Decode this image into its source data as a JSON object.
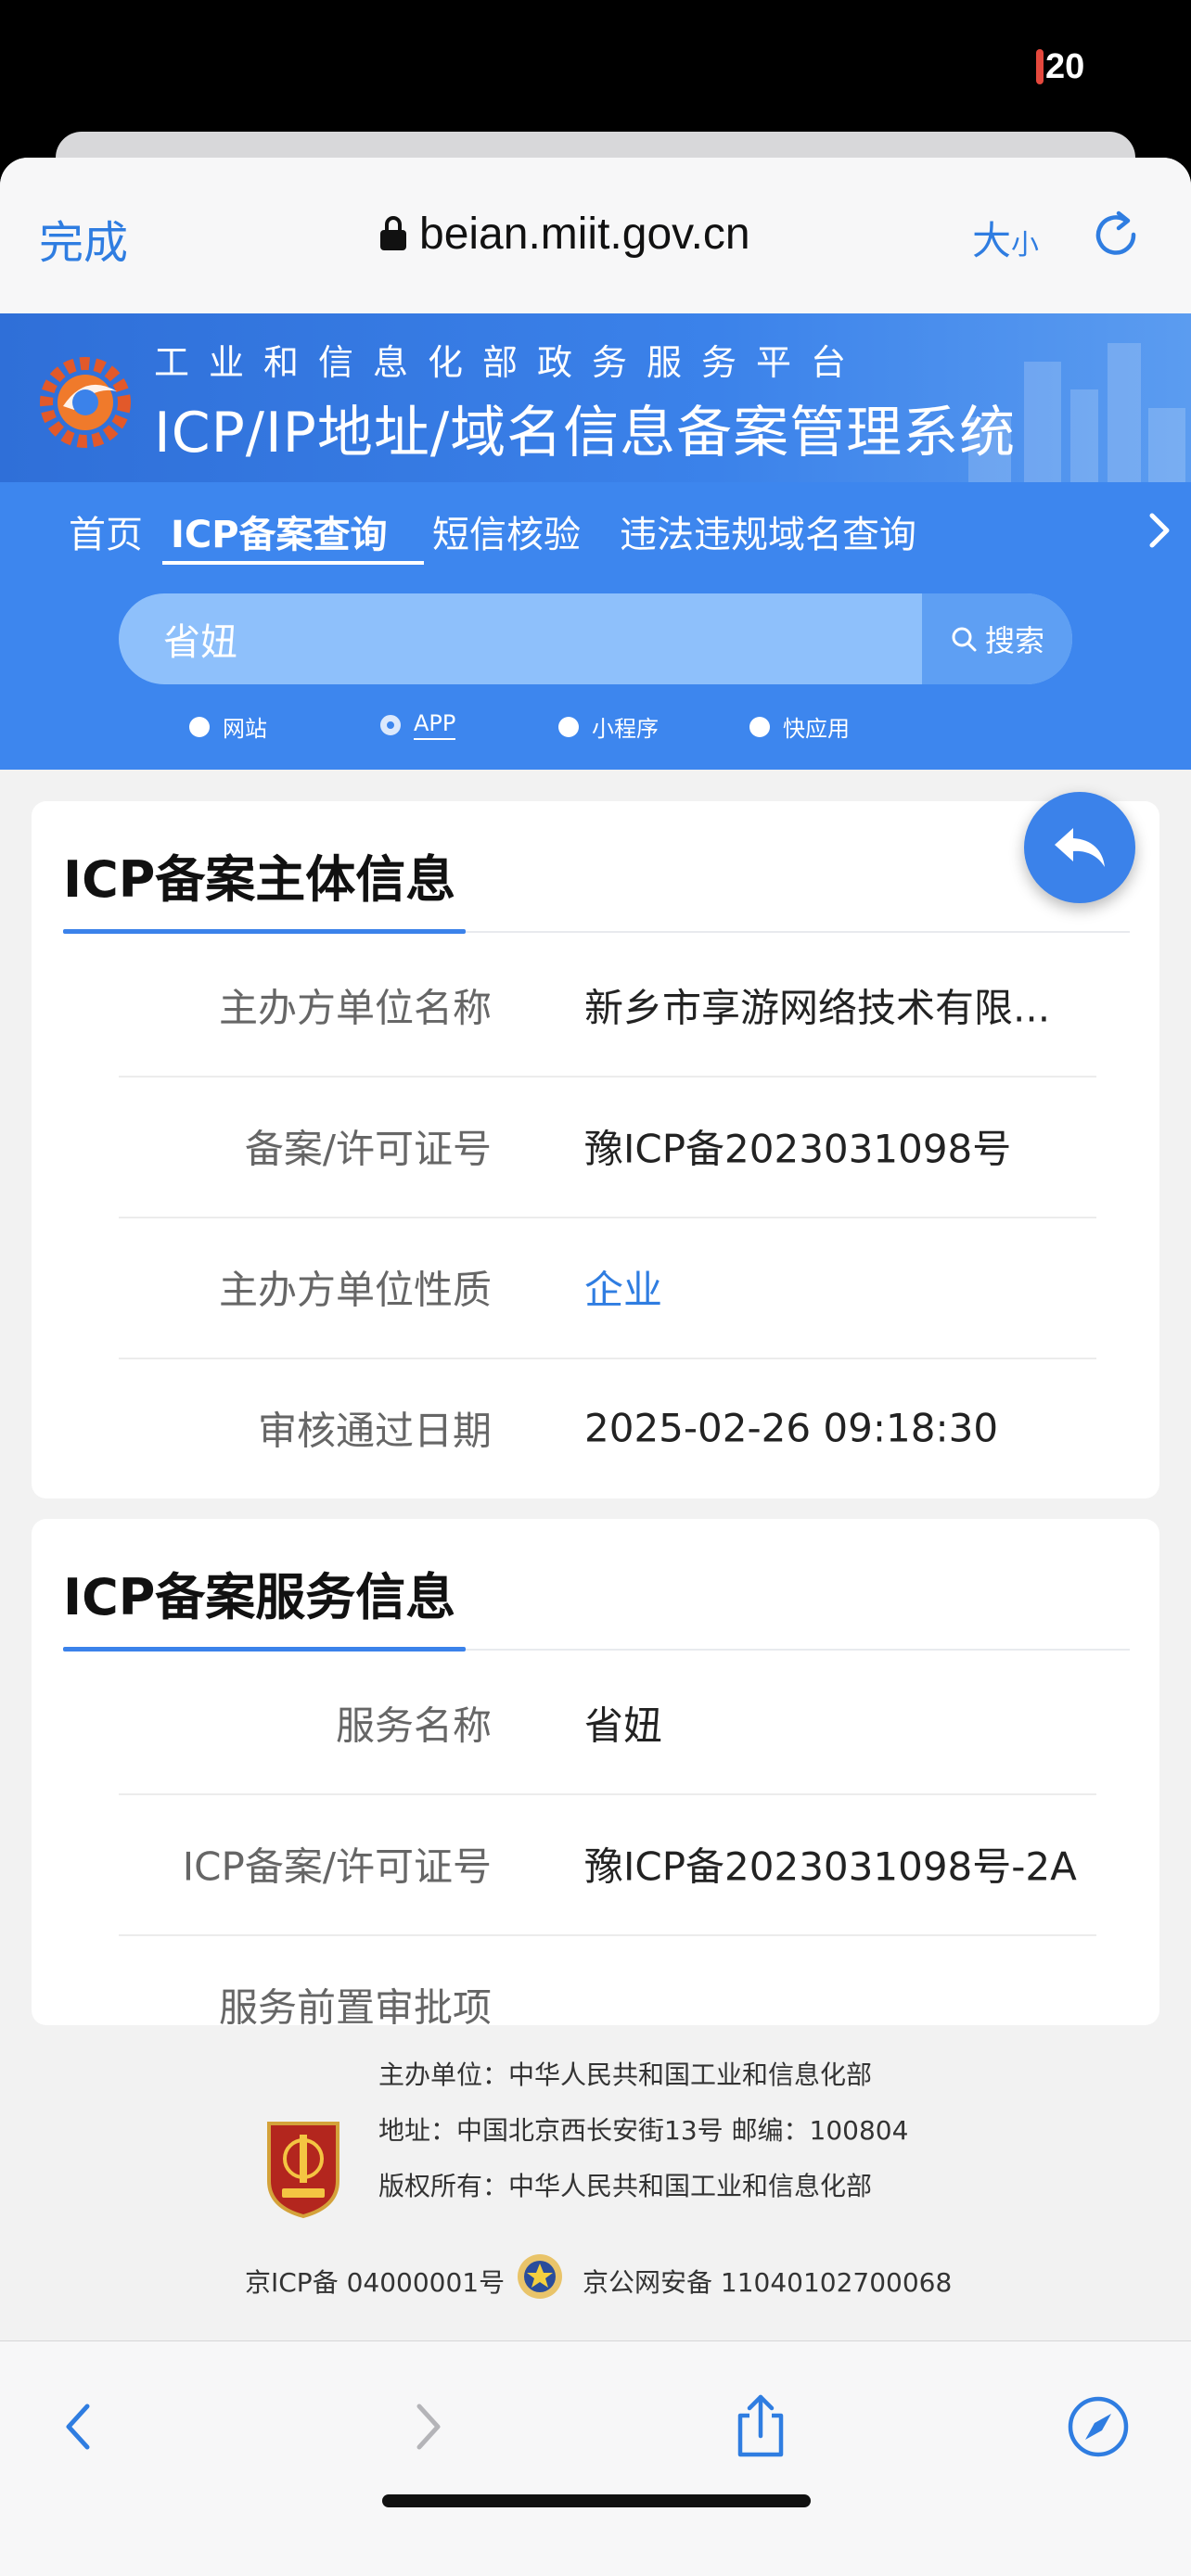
{
  "status_bar": {
    "battery_level": "20"
  },
  "safari": {
    "done_label": "完成",
    "url": "beian.miit.gov.cn",
    "text_size_big": "大",
    "text_size_small": "小"
  },
  "site": {
    "subtitle": "工业和信息化部政务服务平台",
    "title": "ICP/IP地址/域名信息备案管理系统"
  },
  "nav": {
    "items": [
      {
        "label": "首页",
        "active": false
      },
      {
        "label": "ICP备案查询",
        "active": true
      },
      {
        "label": "短信核验",
        "active": false
      },
      {
        "label": "违法违规域名查询",
        "active": false
      }
    ]
  },
  "search": {
    "value": "省妞",
    "button_label": "搜索"
  },
  "search_types": [
    {
      "label": "网站",
      "selected": false
    },
    {
      "label": "APP",
      "selected": true
    },
    {
      "label": "小程序",
      "selected": false
    },
    {
      "label": "快应用",
      "selected": false
    }
  ],
  "entity_card": {
    "title": "ICP备案主体信息",
    "rows": [
      {
        "label": "主办方单位名称",
        "value": "新乡市享游网络技术有限..."
      },
      {
        "label": "备案/许可证号",
        "value": "豫ICP备2023031098号"
      },
      {
        "label": "主办方单位性质",
        "value": "企业"
      },
      {
        "label": "审核通过日期",
        "value": "2025-02-26 09:18:30"
      }
    ]
  },
  "service_card": {
    "title": "ICP备案服务信息",
    "rows": [
      {
        "label": "服务名称",
        "value": "省妞"
      },
      {
        "label": "ICP备案/许可证号",
        "value": "豫ICP备2023031098号-2A"
      },
      {
        "label": "服务前置审批项",
        "value": ""
      }
    ]
  },
  "footer": {
    "sponsor": "主办单位：中华人民共和国工业和信息化部",
    "address": "地址：中国北京西长安街13号 邮编：100804",
    "copyright": "版权所有：中华人民共和国工业和信息化部",
    "icp": "京ICP备 04000001号",
    "police": "京公网安备 11040102700068"
  },
  "colors": {
    "accent": "#3b82ea",
    "link": "#2f7de1",
    "header_blue": "#2f6fd8"
  }
}
